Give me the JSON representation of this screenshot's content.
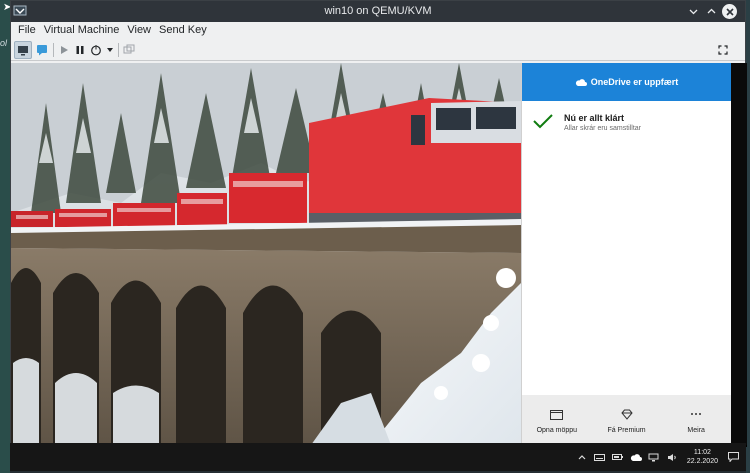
{
  "window": {
    "title": "win10 on QEMU/KVM"
  },
  "menu": [
    "File",
    "Virtual Machine",
    "View",
    "Send Key"
  ],
  "host": {
    "edge_text": "ol"
  },
  "onedrive": {
    "header": "OneDrive er uppfært",
    "status_title": "Nú er allt klárt",
    "status_subtitle": "Allar skrár eru samstilltar",
    "actions": [
      "Opna möppu",
      "Fá Premium",
      "Meira"
    ]
  },
  "taskbar": {
    "time": "11:02",
    "date": "22.2.2020"
  },
  "colors": {
    "onedrive_blue": "#1c83d8",
    "check_green": "#107c10"
  }
}
